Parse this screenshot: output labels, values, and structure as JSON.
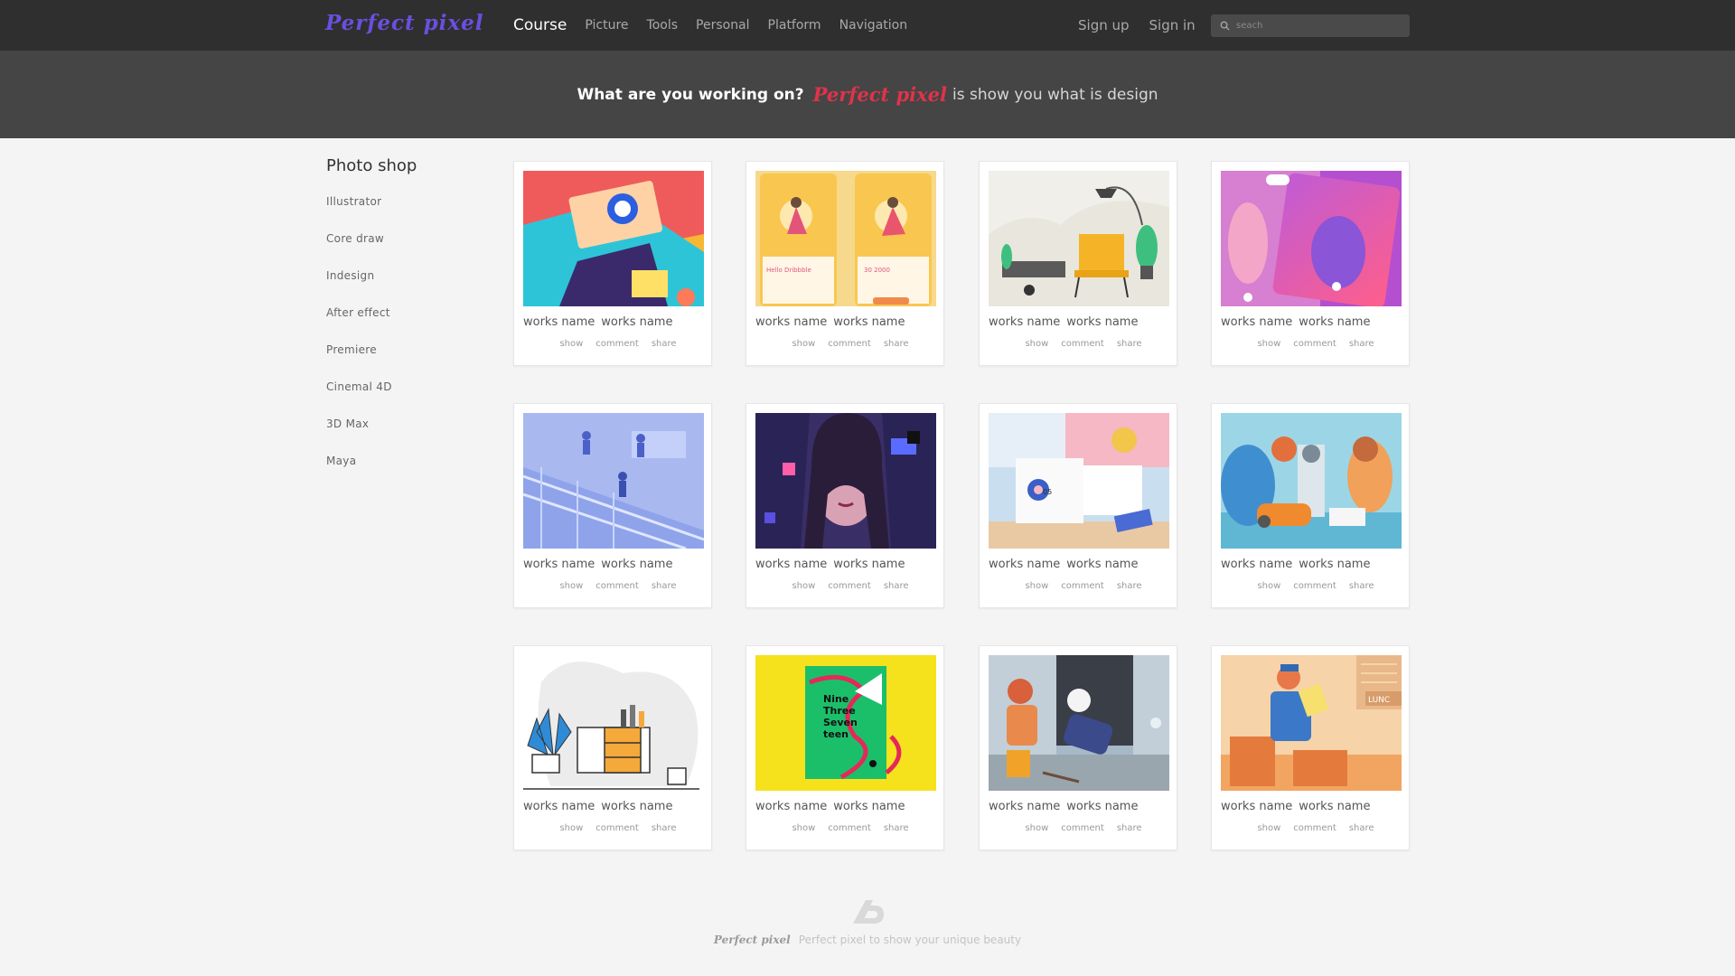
{
  "header": {
    "logo": "Perfect pixel",
    "nav": [
      "Course",
      "Picture",
      "Tools",
      "Personal",
      "Platform",
      "Navigation"
    ],
    "active_nav": "Course",
    "sign_up": "Sign up",
    "sign_in": "Sign in",
    "search_placeholder": "seach",
    "search_icon": "search-icon"
  },
  "hero": {
    "question": "What are you working on?",
    "brand": "Perfect pixel",
    "tagline": "is show you what is design"
  },
  "sidebar": {
    "title": "Photo shop",
    "items": [
      "Illustrator",
      "Core draw",
      "Indesign",
      "After effect",
      "Premiere",
      "Cinemal 4D",
      "3D Max",
      "Maya"
    ]
  },
  "cards": [
    {
      "title_a": "works name",
      "title_b": "works name",
      "show": "show",
      "comment": "comment",
      "share": "share"
    },
    {
      "title_a": "works name",
      "title_b": "works name",
      "show": "show",
      "comment": "comment",
      "share": "share"
    },
    {
      "title_a": "works name",
      "title_b": "works name",
      "show": "show",
      "comment": "comment",
      "share": "share"
    },
    {
      "title_a": "works name",
      "title_b": "works name",
      "show": "show",
      "comment": "comment",
      "share": "share"
    },
    {
      "title_a": "works name",
      "title_b": "works name",
      "show": "show",
      "comment": "comment",
      "share": "share"
    },
    {
      "title_a": "works name",
      "title_b": "works name",
      "show": "show",
      "comment": "comment",
      "share": "share"
    },
    {
      "title_a": "works name",
      "title_b": "works name",
      "show": "show",
      "comment": "comment",
      "share": "share"
    },
    {
      "title_a": "works name",
      "title_b": "works name",
      "show": "show",
      "comment": "comment",
      "share": "share"
    },
    {
      "title_a": "works name",
      "title_b": "works name",
      "show": "show",
      "comment": "comment",
      "share": "share"
    },
    {
      "title_a": "works name",
      "title_b": "works name",
      "show": "show",
      "comment": "comment",
      "share": "share"
    },
    {
      "title_a": "works name",
      "title_b": "works name",
      "show": "show",
      "comment": "comment",
      "share": "share"
    },
    {
      "title_a": "works name",
      "title_b": "works name",
      "show": "show",
      "comment": "comment",
      "share": "share"
    }
  ],
  "footer": {
    "brand": "Perfect pixel",
    "text": "Perfect pixel to show your unique beauty"
  },
  "colors": {
    "topbar": "#2f2f2f",
    "hero": "#454545",
    "logo": "#6a4fe0",
    "brand_red": "#e0334a",
    "page_bg": "#f4f4f4"
  }
}
